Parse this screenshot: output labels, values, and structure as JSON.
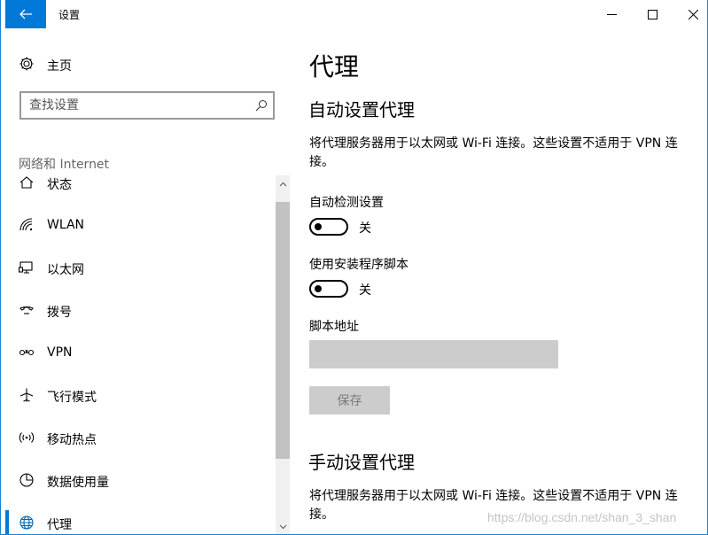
{
  "titlebar": {
    "title": "设置"
  },
  "sidebar": {
    "home_label": "主页",
    "search_placeholder": "查找设置",
    "section_header": "网络和 Internet",
    "items": [
      {
        "label": "状态",
        "icon": "home-status-icon"
      },
      {
        "label": "WLAN",
        "icon": "wifi-icon"
      },
      {
        "label": "以太网",
        "icon": "ethernet-icon"
      },
      {
        "label": "拨号",
        "icon": "dialup-icon"
      },
      {
        "label": "VPN",
        "icon": "vpn-icon"
      },
      {
        "label": "飞行模式",
        "icon": "airplane-icon"
      },
      {
        "label": "移动热点",
        "icon": "hotspot-icon"
      },
      {
        "label": "数据使用量",
        "icon": "data-usage-icon"
      },
      {
        "label": "代理",
        "icon": "globe-icon",
        "active": true
      }
    ]
  },
  "content": {
    "page_title": "代理",
    "auto_section": {
      "title": "自动设置代理",
      "description": "将代理服务器用于以太网或 Wi-Fi 连接。这些设置不适用于 VPN 连接。",
      "auto_detect": {
        "label": "自动检测设置",
        "state": "关",
        "on": false
      },
      "use_script": {
        "label": "使用安装程序脚本",
        "state": "关",
        "on": false
      },
      "script_address_label": "脚本地址",
      "script_address_value": "",
      "save_label": "保存"
    },
    "manual_section": {
      "title": "手动设置代理",
      "description": "将代理服务器用于以太网或 Wi-Fi 连接。这些设置不适用于 VPN 连接。"
    }
  },
  "watermark": "https://blog.csdn.net/shan_3_shan",
  "colors": {
    "accent": "#0078d7",
    "disabled_bg": "#cccccc",
    "disabled_text": "#7a7a7a"
  }
}
